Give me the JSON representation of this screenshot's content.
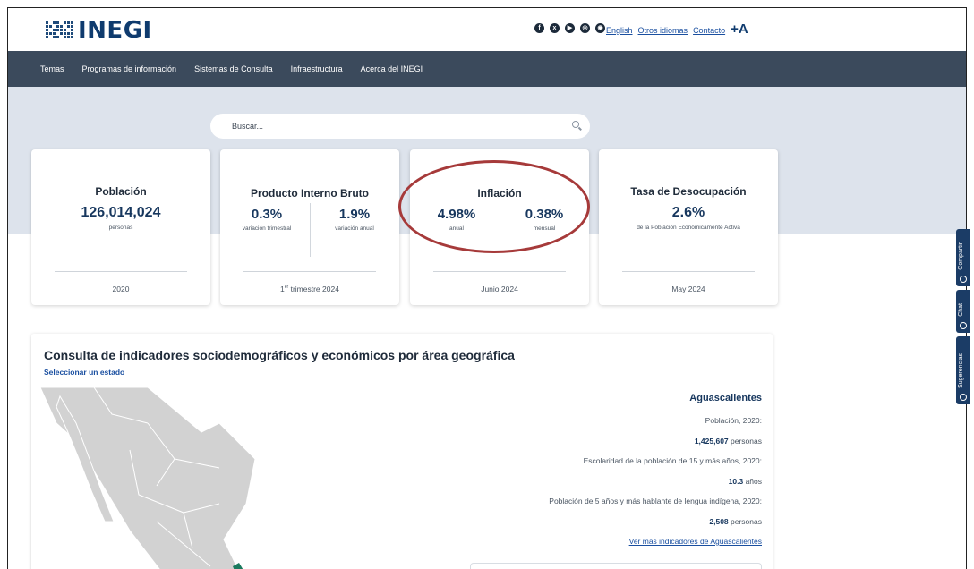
{
  "header": {
    "logo_text": "INEGI",
    "social_icons": [
      "facebook-icon",
      "x-icon",
      "youtube-icon",
      "instagram-icon",
      "rss-icon"
    ],
    "links": [
      "English",
      "Otros idiomas",
      "Contacto"
    ],
    "font_size_label": "+A"
  },
  "nav": {
    "items": [
      "Temas",
      "Programas de información",
      "Sistemas de Consulta",
      "Infraestructura",
      "Acerca del INEGI"
    ]
  },
  "search": {
    "placeholder": "Buscar..."
  },
  "cards": {
    "poblacion": {
      "title": "Población",
      "value": "126,014,024",
      "unit": "personas",
      "period": "2020"
    },
    "pib": {
      "title": "Producto Interno Bruto",
      "left_value": "0.3%",
      "left_label": "variación trimestral",
      "right_value": "1.9%",
      "right_label": "variación anual",
      "period_prefix": "1",
      "period_sup": "er",
      "period_suffix": " trimestre 2024"
    },
    "inflacion": {
      "title": "Inflación",
      "left_value": "4.98%",
      "left_label": "anual",
      "right_value": "0.38%",
      "right_label": "mensual",
      "period": "Junio 2024"
    },
    "desocupacion": {
      "title": "Tasa de Desocupación",
      "value": "2.6%",
      "unit": "de la Población Económicamente Activa",
      "period": "May 2024"
    }
  },
  "side_tabs": [
    "Compartir",
    "Chat",
    "Sugerencias"
  ],
  "panel": {
    "title": "Consulta de indicadores sociodemográficos y económicos por área geográfica",
    "select_link": "Seleccionar un estado",
    "state": "Aguascalientes",
    "pob_label": "Población, 2020:",
    "pob_value": "1,425,607",
    "pob_unit": " personas",
    "esc_label": "Escolaridad de la población de 15 y más años, 2020:",
    "esc_value": "10.3",
    "esc_unit": " años",
    "ind_label": "Población de 5 años y más hablante de lengua indígena, 2020:",
    "ind_value": "2,508",
    "ind_unit": " personas",
    "more_link": "Ver más indicadores de Aguascalientes"
  },
  "colors": {
    "nav_bg": "#3b4a5c",
    "hero_bg": "#dde3ec",
    "accent": "#17375e",
    "highlight": "#a63a3a"
  }
}
